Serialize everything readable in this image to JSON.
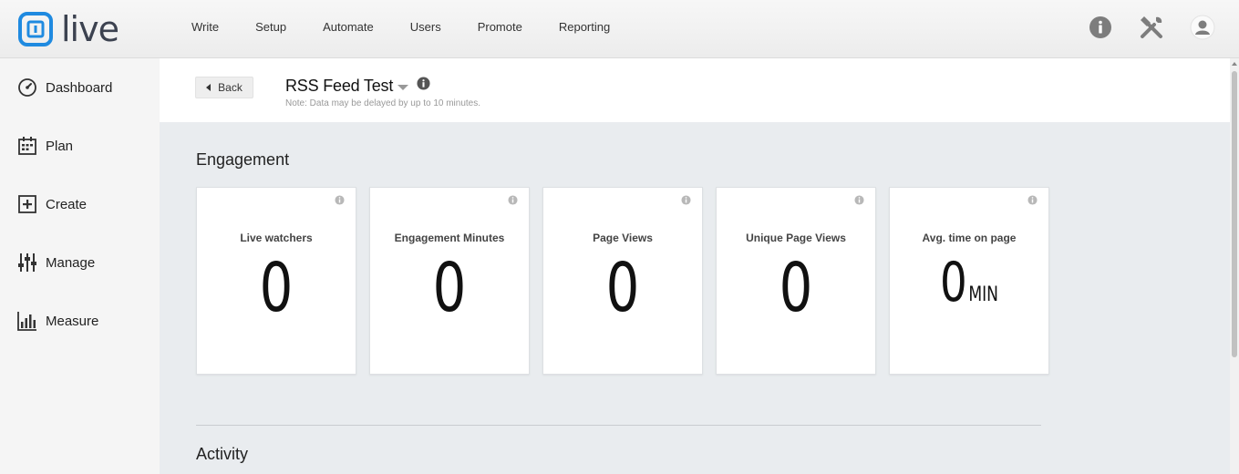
{
  "app": {
    "logo_text": "live"
  },
  "topnav": {
    "items": [
      "Write",
      "Setup",
      "Automate",
      "Users",
      "Promote",
      "Reporting"
    ]
  },
  "top_icons": [
    "info-icon",
    "tools-icon",
    "user-avatar-icon"
  ],
  "sidebar": {
    "items": [
      {
        "label": "Dashboard",
        "icon": "gauge-icon"
      },
      {
        "label": "Plan",
        "icon": "calendar-icon"
      },
      {
        "label": "Create",
        "icon": "plus-box-icon"
      },
      {
        "label": "Manage",
        "icon": "sliders-icon"
      },
      {
        "label": "Measure",
        "icon": "bar-chart-icon"
      }
    ]
  },
  "subheader": {
    "back_label": "Back",
    "title": "RSS Feed Test",
    "note": "Note: Data may be delayed by up to 10 minutes."
  },
  "engagement": {
    "title": "Engagement",
    "cards": [
      {
        "label": "Live watchers",
        "value": "0"
      },
      {
        "label": "Engagement Minutes",
        "value": "0"
      },
      {
        "label": "Page Views",
        "value": "0"
      },
      {
        "label": "Unique Page Views",
        "value": "0"
      },
      {
        "label": "Avg. time on page",
        "value": "0",
        "unit": "MIN"
      }
    ]
  },
  "activity": {
    "title": "Activity"
  },
  "colors": {
    "brand_blue": "#1f8ae0",
    "logo_dark": "#3c4250"
  }
}
